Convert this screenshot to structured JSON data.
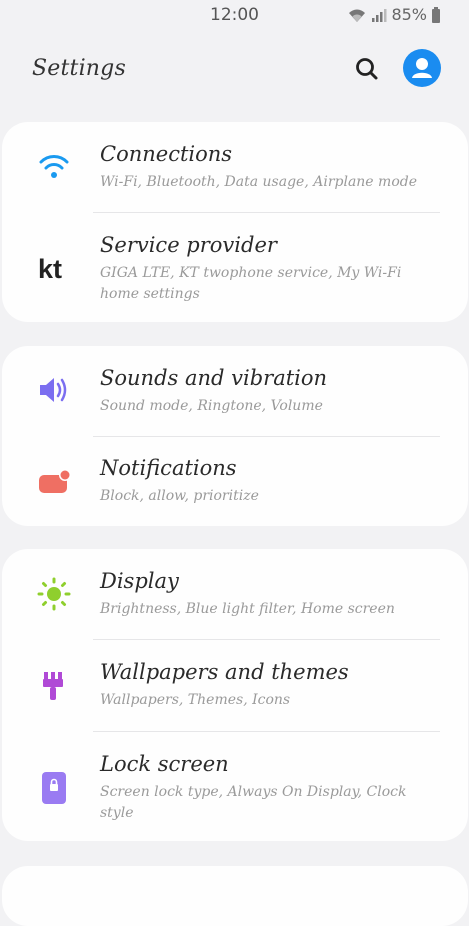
{
  "status_bar": {
    "time": "12:00",
    "battery_percent": "85%",
    "icons": [
      "wifi-icon",
      "signal-icon",
      "battery-icon"
    ]
  },
  "header": {
    "title": "Settings",
    "search_icon": "search-icon",
    "account_icon": "account-icon",
    "accent_color": "#1a8cf0"
  },
  "groups": [
    {
      "items": [
        {
          "icon": "wifi-icon",
          "title": "Connections",
          "subtitle": "Wi-Fi, Bluetooth, Data usage, Airplane mode",
          "icon_color": "#1a9af0"
        },
        {
          "icon": "kt-logo-icon",
          "title": "Service provider",
          "subtitle": "GIGA LTE, KT twophone service, My Wi-Fi home settings",
          "icon_color": "#222222",
          "logo_text": "kt"
        }
      ]
    },
    {
      "items": [
        {
          "icon": "speaker-icon",
          "title": "Sounds and vibration",
          "subtitle": "Sound mode, Ringtone, Volume",
          "icon_color": "#7b6ef0"
        },
        {
          "icon": "notification-icon",
          "title": "Notifications",
          "subtitle": "Block, allow, prioritize",
          "icon_color": "#ef6f63"
        }
      ]
    },
    {
      "items": [
        {
          "icon": "brightness-icon",
          "title": "Display",
          "subtitle": "Brightness, Blue light filter, Home screen",
          "icon_color": "#8fcf2d"
        },
        {
          "icon": "paintbrush-icon",
          "title": "Wallpapers and themes",
          "subtitle": "Wallpapers, Themes, Icons",
          "icon_color": "#b04ad6"
        },
        {
          "icon": "lock-icon",
          "title": "Lock screen",
          "subtitle": "Screen lock type, Always On Display, Clock style",
          "icon_color": "#9a7bf2"
        }
      ]
    }
  ]
}
